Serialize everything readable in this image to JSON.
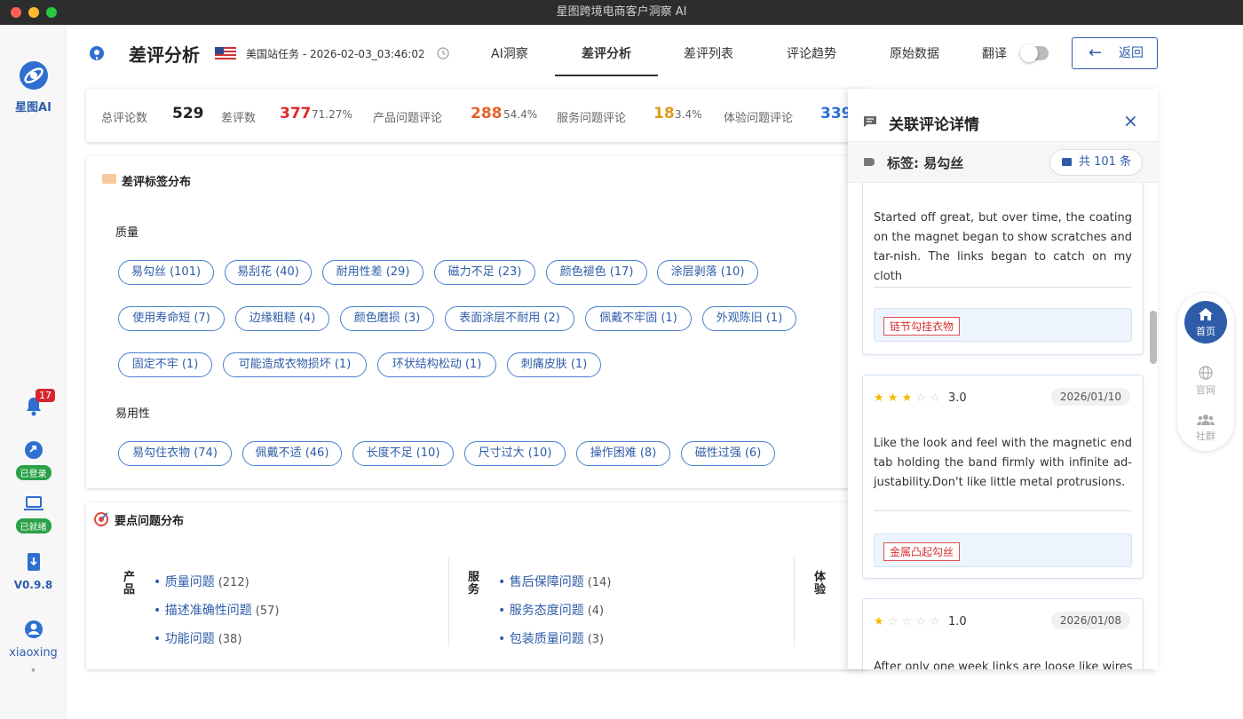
{
  "window": {
    "title": "星图跨境电商客户洞察 AI"
  },
  "sidebar": {
    "brand": "星图AI",
    "notifications_count": "17",
    "login_status": "已登录",
    "ready_status": "已就绪",
    "version": "V0.9.8",
    "username": "xiaoxing"
  },
  "header": {
    "title": "差评分析",
    "task": "美国站任务 - 2026-02-03_03:46:02",
    "tabs": [
      "AI洞察",
      "差评分析",
      "差评列表",
      "评论趋势",
      "原始数据"
    ],
    "active_tab": "差评分析",
    "translate_label": "翻译",
    "back_label": "返回"
  },
  "stats": {
    "total_label": "总评论数",
    "total": "529",
    "neg_label": "差评数",
    "neg": "377",
    "neg_pct": "71.27%",
    "product_label": "产品问题评论",
    "product": "288",
    "product_pct": "54.4%",
    "service_label": "服务问题评论",
    "service": "18",
    "service_pct": "3.4%",
    "exp_label": "体验问题评论",
    "exp": "339"
  },
  "tag_dist": {
    "title": "差评标签分布",
    "groups": [
      {
        "name": "质量",
        "tags": [
          "易勾丝 (101)",
          "易刮花 (40)",
          "耐用性差 (29)",
          "磁力不足 (23)",
          "颜色褪色 (17)",
          "涂层剥落 (10)",
          "使用寿命短 (7)",
          "边缘粗糙 (4)",
          "颜色磨损 (3)",
          "表面涂层不耐用 (2)",
          "佩戴不牢固 (1)",
          "外观陈旧 (1)",
          "固定不牢 (1)",
          "可能造成衣物损坏 (1)",
          "环状结构松动 (1)",
          "刺痛皮肤 (1)"
        ]
      },
      {
        "name": "易用性",
        "tags": [
          "易勾住衣物 (74)",
          "佩戴不适 (46)",
          "长度不足 (10)",
          "尺寸过大 (10)",
          "操作困难 (8)",
          "磁性过强 (6)"
        ]
      }
    ]
  },
  "key_issues": {
    "title": "要点问题分布",
    "product_label": "产品",
    "service_label": "服务",
    "exp_label": "体验",
    "product": [
      {
        "name": "质量问题",
        "count": "(212)"
      },
      {
        "name": "描述准确性问题",
        "count": "(57)"
      },
      {
        "name": "功能问题",
        "count": "(38)"
      }
    ],
    "service": [
      {
        "name": "售后保障问题",
        "count": "(14)"
      },
      {
        "name": "服务态度问题",
        "count": "(4)"
      },
      {
        "name": "包装质量问题",
        "count": "(3)"
      }
    ]
  },
  "panel": {
    "title": "关联评论详情",
    "tag_label": "标签: 易勾丝",
    "total_label": "共 101 条",
    "reviews": [
      {
        "text": "Started off great, but over time, the coating on the magnet began to show scratches and tar-nish. The links began to catch on my cloth",
        "tag": "链节勾挂衣物"
      },
      {
        "rating": "3.0",
        "stars": 3,
        "date": "2026/01/10",
        "text": "Like the look and feel with the magnetic end tab holding the band firmly with infinite ad-justability.Don't like little metal protrusions.",
        "tag": "金属凸起勾丝"
      },
      {
        "rating": "1.0",
        "stars": 1,
        "date": "2026/01/08",
        "text": "After only one week links are loose like wires"
      }
    ]
  },
  "floating": {
    "home": "首页",
    "site": "官网",
    "community": "社群"
  },
  "colors": {
    "primary": "#2e5ca8",
    "neg": "#e0282e",
    "product": "#e8622a",
    "service": "#e39a1e",
    "exp": "#2a6fd8"
  }
}
